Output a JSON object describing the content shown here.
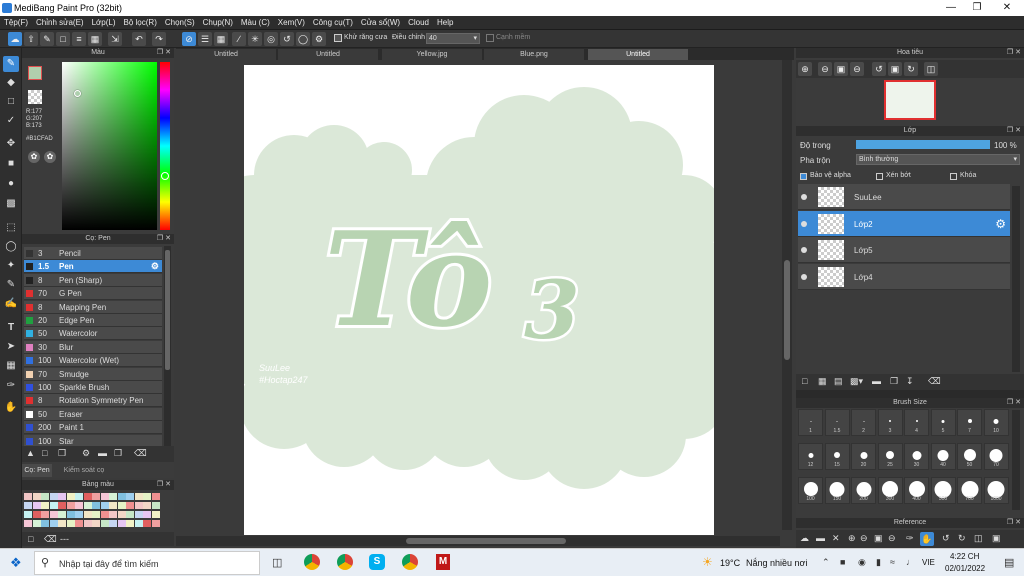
{
  "window": {
    "title": "MediBang Paint Pro (32bit)"
  },
  "menu": [
    "Tệp(F)",
    "Chỉnh sửa(E)",
    "Lớp(L)",
    "Bộ lọc(R)",
    "Chọn(S)",
    "Chụp(N)",
    "Màu (C)",
    "Xem(V)",
    "Công cụ(T)",
    "Cửa sổ(W)",
    "Cloud",
    "Help"
  ],
  "toolbar": {
    "antialias_label": "Khử răng cưa",
    "adjust_label": "Điều chỉnh",
    "adjust_value": "40",
    "edge_label": "Cạnh mềm"
  },
  "color_panel": {
    "title": "Màu",
    "r": "R:177",
    "g": "G:207",
    "b": "B:173",
    "hex": "#B1CFAD",
    "current_color": "#b1cfad"
  },
  "brush_panel": {
    "title": "Cọ: Pen",
    "items": [
      {
        "size": "3",
        "name": "Pencil",
        "color": "#333333"
      },
      {
        "size": "1.5",
        "name": "Pen",
        "color": "#222222"
      },
      {
        "size": "8",
        "name": "Pen (Sharp)",
        "color": "#222222"
      },
      {
        "size": "70",
        "name": "G Pen",
        "color": "#e03030"
      },
      {
        "size": "8",
        "name": "Mapping Pen",
        "color": "#e03030"
      },
      {
        "size": "20",
        "name": "Edge Pen",
        "color": "#20a040"
      },
      {
        "size": "50",
        "name": "Watercolor",
        "color": "#30b0e0"
      },
      {
        "size": "30",
        "name": "Blur",
        "color": "#e080c0"
      },
      {
        "size": "100",
        "name": "Watercolor (Wet)",
        "color": "#3070e0"
      },
      {
        "size": "70",
        "name": "Smudge",
        "color": "#f0d0b0"
      },
      {
        "size": "100",
        "name": "Sparkle Brush",
        "color": "#3050e0"
      },
      {
        "size": "8",
        "name": "Rotation Symmetry Pen",
        "color": "#e03030"
      },
      {
        "size": "50",
        "name": "Eraser",
        "color": "#ffffff"
      },
      {
        "size": "200",
        "name": "Paint 1",
        "color": "#3050d0"
      },
      {
        "size": "100",
        "name": "Star",
        "color": "#3050d0"
      }
    ],
    "tab_brush": "Cọ: Pen",
    "tab_control": "Kiểm soát cọ"
  },
  "palette_panel": {
    "title": "Bảng màu",
    "footer": "---"
  },
  "tabs": [
    "Untitled",
    "Untitled",
    "Yellow.jpg",
    "Blue.png",
    "Untitled"
  ],
  "canvas": {
    "main_text": "Tô",
    "sub_text": "3",
    "signature_1": "SuuLee",
    "signature_2": "#Hoctap247"
  },
  "navigator": {
    "title": "Hoa tiêu"
  },
  "layer_panel": {
    "title": "Lớp",
    "opacity_label": "Độ trong",
    "opacity_value": "100 %",
    "opacity_fraction": 1.0,
    "blend_label": "Pha trộn",
    "blend_value": "Bình thường",
    "protect_alpha": "Bảo vệ alpha",
    "clipping": "Xén bớt",
    "lock": "Khóa",
    "layers": [
      {
        "name": "SuuLee",
        "selected": false
      },
      {
        "name": "Lớp2",
        "selected": true
      },
      {
        "name": "Lớp5",
        "selected": false
      },
      {
        "name": "Lớp4",
        "selected": false
      }
    ]
  },
  "brush_size": {
    "title": "Brush Size",
    "sizes": [
      "1",
      "1.5",
      "2",
      "3",
      "4",
      "5",
      "7",
      "10",
      "12",
      "15",
      "20",
      "25",
      "30",
      "40",
      "50",
      "70",
      "100",
      "150",
      "200",
      "300",
      "400",
      "500",
      "700",
      "1000"
    ]
  },
  "reference": {
    "title": "Reference"
  },
  "taskbar": {
    "search_placeholder": "Nhập tại đây để tìm kiếm",
    "temperature": "19°C",
    "weather": "Nắng nhiều nơi",
    "lang": "VIE",
    "time": "4:22 CH",
    "date": "02/01/2022"
  }
}
